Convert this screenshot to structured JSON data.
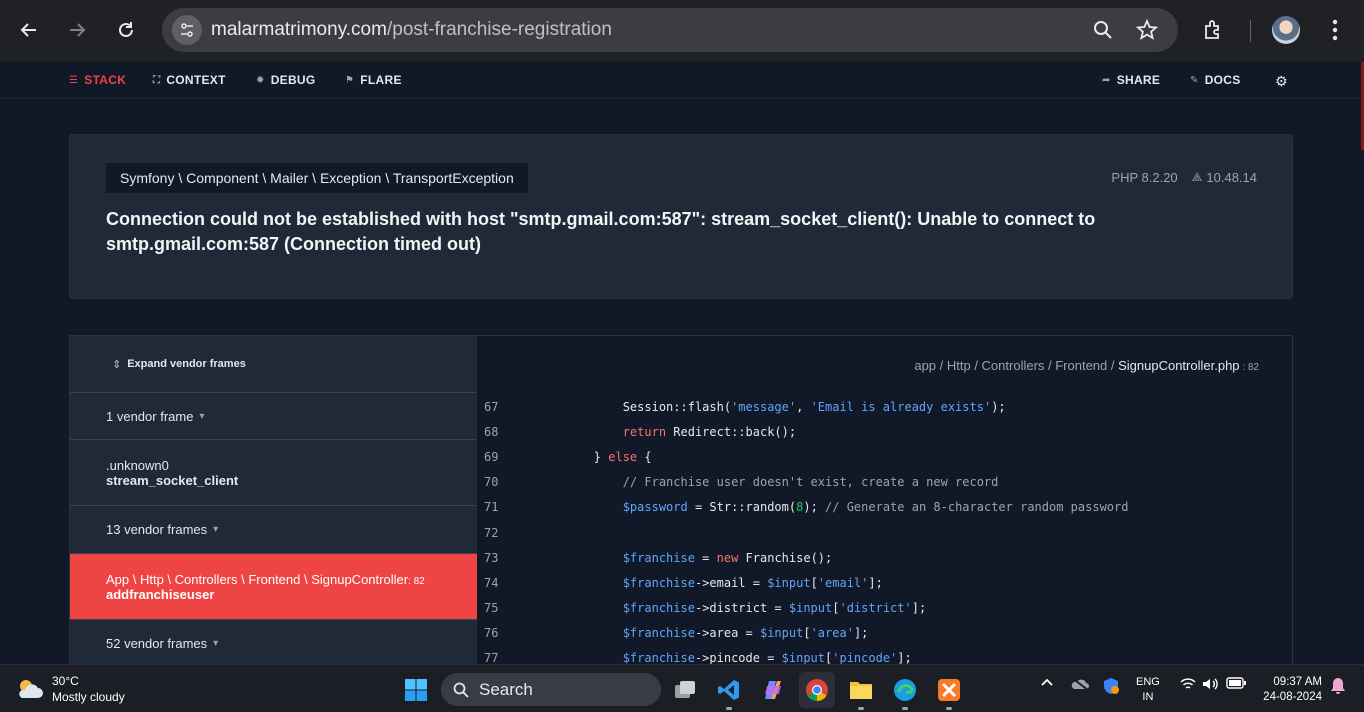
{
  "browser": {
    "url_host": "malarmatrimony.com",
    "url_path": "/post-franchise-registration"
  },
  "ignition": {
    "tabs_left": [
      {
        "label": "STACK",
        "icon": "stack-icon",
        "active": true
      },
      {
        "label": "CONTEXT",
        "icon": "context-icon"
      },
      {
        "label": "DEBUG",
        "icon": "bug-icon"
      },
      {
        "label": "FLARE",
        "icon": "flare-icon"
      }
    ],
    "tabs_right": [
      {
        "label": "SHARE",
        "icon": "share-icon"
      },
      {
        "label": "DOCS",
        "icon": "docs-icon"
      }
    ]
  },
  "exception": {
    "class_name": "Symfony \\ Component \\ Mailer \\ Exception \\ TransportException",
    "php_version": "PHP 8.2.20",
    "laravel_version": "10.48.14",
    "message": "Connection could not be established with host \"smtp.gmail.com:587\": stream_socket_client(): Unable to connect to smtp.gmail.com:587 (Connection timed out)"
  },
  "frames": {
    "expand_label": "Expand vendor frames",
    "items": [
      {
        "type": "group",
        "label": "1 vendor frame"
      },
      {
        "type": "frame",
        "file": ".unknown0",
        "method": "stream_socket_client"
      },
      {
        "type": "group",
        "label": "13 vendor frames"
      },
      {
        "type": "frame",
        "file": "App \\ Http \\ Controllers \\ Frontend \\ SignupController",
        "line": ": 82",
        "method": "addfranchiseuser",
        "active": true
      },
      {
        "type": "group",
        "label": "52 vendor frames"
      }
    ]
  },
  "code": {
    "path_prefix": "app / Http / Controllers / Frontend / ",
    "file_name": "SignupController.php",
    "line_suffix": " : 82",
    "lines": [
      {
        "n": "67",
        "text": "            Session::flash('message', 'Email is already exists');"
      },
      {
        "n": "68",
        "text": "            return Redirect::back();"
      },
      {
        "n": "69",
        "text": "        } else {"
      },
      {
        "n": "70",
        "text": "            // Franchise user doesn't exist, create a new record"
      },
      {
        "n": "71",
        "text": "            $password = Str::random(8); // Generate an 8-character random password"
      },
      {
        "n": "72",
        "text": ""
      },
      {
        "n": "73",
        "text": "            $franchise = new Franchise();"
      },
      {
        "n": "74",
        "text": "            $franchise->email = $input['email'];"
      },
      {
        "n": "75",
        "text": "            $franchise->district = $input['district'];"
      },
      {
        "n": "76",
        "text": "            $franchise->area = $input['area'];"
      },
      {
        "n": "77",
        "text": "            $franchise->pincode = $input['pincode'];"
      }
    ]
  },
  "taskbar": {
    "temperature": "30°C",
    "weather": "Mostly cloudy",
    "search_label": "Search",
    "lang_line1": "ENG",
    "lang_line2": "IN",
    "time": "09:37 AM",
    "date": "24-08-2024"
  }
}
